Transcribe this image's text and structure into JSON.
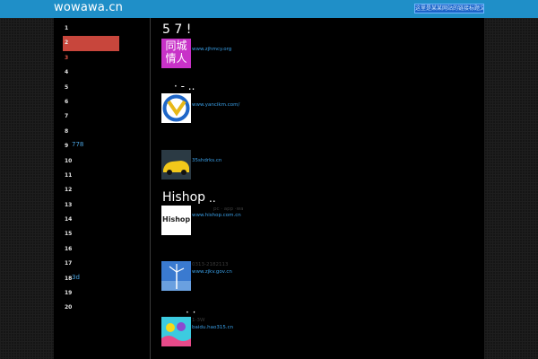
{
  "header": {
    "site_title": "wowawa.cn",
    "top_link": "这里是某某网站的链接标题文字"
  },
  "sidebar": {
    "items": [
      {
        "num": "1",
        "label": ""
      },
      {
        "num": "2",
        "label": ""
      },
      {
        "num": "3",
        "label": ""
      },
      {
        "num": "4",
        "label": ""
      },
      {
        "num": "5",
        "label": ""
      },
      {
        "num": "6",
        "label": ""
      },
      {
        "num": "7",
        "label": ""
      },
      {
        "num": "8",
        "label": ""
      },
      {
        "num": "9",
        "label": "778"
      },
      {
        "num": "10",
        "label": ""
      },
      {
        "num": "11",
        "label": ""
      },
      {
        "num": "12",
        "label": ""
      },
      {
        "num": "13",
        "label": ""
      },
      {
        "num": "14",
        "label": ""
      },
      {
        "num": "15",
        "label": ""
      },
      {
        "num": "16",
        "label": ""
      },
      {
        "num": "17",
        "label": ""
      },
      {
        "num": "18",
        "label": "3d"
      },
      {
        "num": "19",
        "label": ""
      },
      {
        "num": "20",
        "label": ""
      }
    ]
  },
  "entries": {
    "e1": {
      "heading": "5  7  !",
      "logo_text_1": "同城",
      "logo_text_2": "情人",
      "url": "www.zjhmcy.org"
    },
    "e2": {
      "heading": "·  -  ..",
      "url": "www.yancikm.com/"
    },
    "e3": {
      "url": "35shdrks.cn"
    },
    "e4": {
      "heading": "Hishop",
      "heading_suffix": "..",
      "logo_text": "Hishop",
      "faint": "pc  ·  app  ·wa",
      "url": "www.hishop.com.cn"
    },
    "e5": {
      "faint": "0313-2182113",
      "url": "www.zjkv.gov.cn"
    },
    "e6": {
      "heading": "·  ·",
      "faint": "1-3W",
      "url": "baidu.hao315.cn"
    }
  },
  "colors": {
    "topbar": "#1f8fc8",
    "active_rank": "#c8463c",
    "link": "#3aa0e8"
  }
}
